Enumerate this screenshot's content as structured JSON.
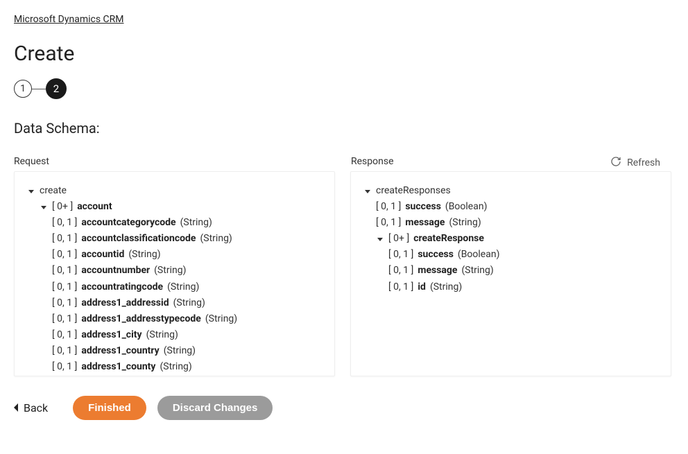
{
  "breadcrumb": "Microsoft Dynamics CRM",
  "page_title": "Create",
  "steps": {
    "one": "1",
    "two": "2"
  },
  "section_title": "Data Schema:",
  "refresh_label": "Refresh",
  "columns": {
    "request_label": "Request",
    "response_label": "Response"
  },
  "request_tree": {
    "root": "create",
    "account": {
      "card": "[ 0+ ]",
      "name": "account"
    },
    "fields": [
      {
        "card": "[ 0, 1 ]",
        "name": "accountcategorycode",
        "type": "(String)"
      },
      {
        "card": "[ 0, 1 ]",
        "name": "accountclassificationcode",
        "type": "(String)"
      },
      {
        "card": "[ 0, 1 ]",
        "name": "accountid",
        "type": "(String)"
      },
      {
        "card": "[ 0, 1 ]",
        "name": "accountnumber",
        "type": "(String)"
      },
      {
        "card": "[ 0, 1 ]",
        "name": "accountratingcode",
        "type": "(String)"
      },
      {
        "card": "[ 0, 1 ]",
        "name": "address1_addressid",
        "type": "(String)"
      },
      {
        "card": "[ 0, 1 ]",
        "name": "address1_addresstypecode",
        "type": "(String)"
      },
      {
        "card": "[ 0, 1 ]",
        "name": "address1_city",
        "type": "(String)"
      },
      {
        "card": "[ 0, 1 ]",
        "name": "address1_country",
        "type": "(String)"
      },
      {
        "card": "[ 0, 1 ]",
        "name": "address1_county",
        "type": "(String)"
      }
    ]
  },
  "response_tree": {
    "root": "createResponses",
    "top_fields": [
      {
        "card": "[ 0, 1 ]",
        "name": "success",
        "type": "(Boolean)"
      },
      {
        "card": "[ 0, 1 ]",
        "name": "message",
        "type": "(String)"
      }
    ],
    "createResponse": {
      "card": "[ 0+ ]",
      "name": "createResponse"
    },
    "inner_fields": [
      {
        "card": "[ 0, 1 ]",
        "name": "success",
        "type": "(Boolean)"
      },
      {
        "card": "[ 0, 1 ]",
        "name": "message",
        "type": "(String)"
      },
      {
        "card": "[ 0, 1 ]",
        "name": "id",
        "type": "(String)"
      }
    ]
  },
  "footer": {
    "back": "Back",
    "finished": "Finished",
    "discard": "Discard Changes"
  }
}
